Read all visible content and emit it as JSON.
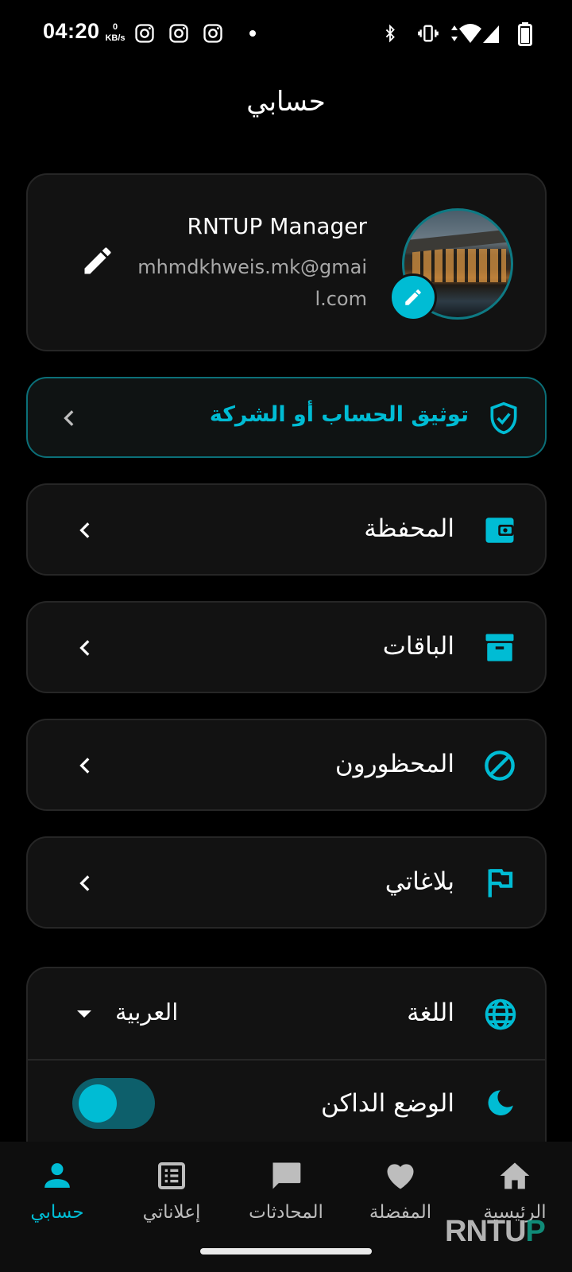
{
  "status_bar": {
    "time": "04:20",
    "speed_value": "0",
    "speed_unit": "KB/s"
  },
  "header": {
    "title": "حسابي"
  },
  "profile": {
    "name": "RNTUP Manager",
    "email": "mhmdkhweis.mk@gmail.com"
  },
  "verify": {
    "label": "توثيق الحساب أو الشركة"
  },
  "menu": [
    {
      "label": "المحفظة",
      "icon": "wallet-icon"
    },
    {
      "label": "الباقات",
      "icon": "archive-box-icon"
    },
    {
      "label": "المحظورون",
      "icon": "block-icon"
    },
    {
      "label": "بلاغاتي",
      "icon": "flag-icon"
    }
  ],
  "settings": {
    "language_label": "اللغة",
    "language_value": "العربية",
    "dark_mode_label": "الوضع الداكن",
    "dark_mode_on": true
  },
  "bottom_nav": [
    {
      "label": "حسابي",
      "icon": "person-icon",
      "active": true
    },
    {
      "label": "إعلاناتي",
      "icon": "list-article-icon",
      "active": false
    },
    {
      "label": "المحادثات",
      "icon": "chat-icon",
      "active": false
    },
    {
      "label": "المفضلة",
      "icon": "heart-icon",
      "active": false
    },
    {
      "label": "الرئيسية",
      "icon": "home-icon",
      "active": false
    }
  ],
  "watermark": {
    "prefix": "RNTU",
    "suffix": "P"
  },
  "colors": {
    "accent": "#00bcd4",
    "card": "#121212",
    "background": "#000000"
  }
}
